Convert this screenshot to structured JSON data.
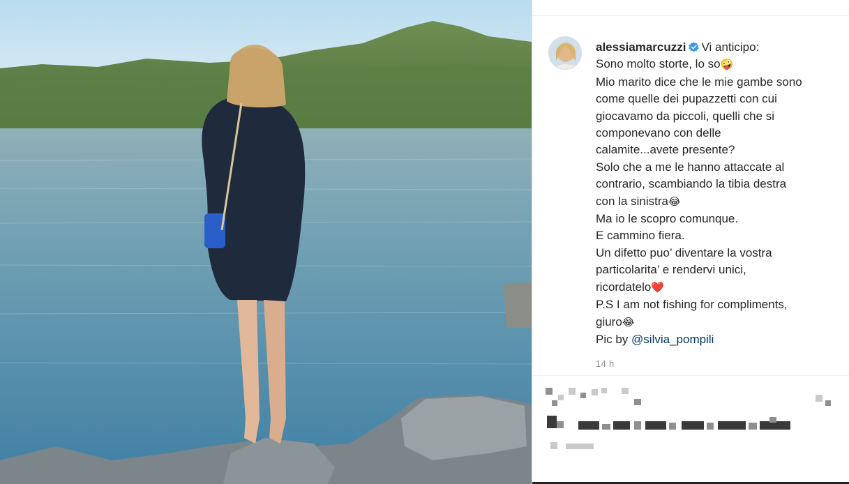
{
  "photo": {
    "description_icon": "lake-photo"
  },
  "post": {
    "username": "alessiamarcuzzi",
    "verified_icon": "verified-badge-icon",
    "lines": [
      "Vi anticipo:",
      "Sono molto storte, lo so",
      "Mio marito dice che le mie gambe sono",
      "come quelle dei pupazzetti con cui",
      "giocavamo da piccoli, quelli che si",
      "componevano con delle",
      "calamite...avete presente?",
      "Solo che a me le hanno attaccate al",
      "contrario, scambiando la tibia destra",
      "con la sinistra",
      "Ma io le scopro comunque.",
      "E cammino fiera.",
      "Un difetto puo’ diventare la vostra",
      "particolarita’ e rendervi unici,",
      "ricordatelo",
      "P.S I am not fishing for compliments,",
      "giuro",
      "Pic by "
    ],
    "emoji": {
      "silly": "🤪",
      "laugh": "😂",
      "heart": "❤️"
    },
    "mention": "@silvia_pompili",
    "time": "14 h"
  },
  "colors": {
    "verified": "#3897f0",
    "mention": "#00376b",
    "text": "#262626",
    "muted": "#8e8e8e"
  }
}
